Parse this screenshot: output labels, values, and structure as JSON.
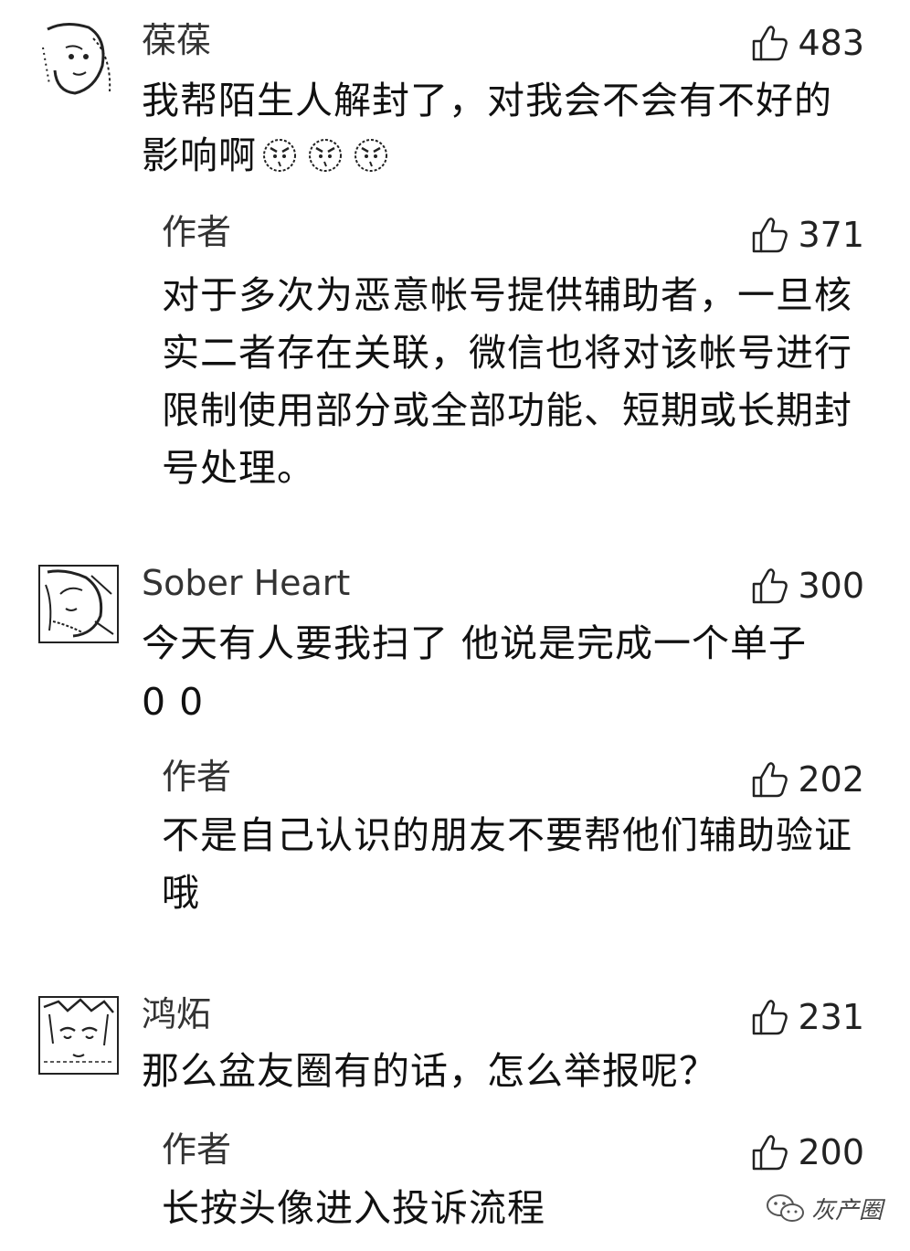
{
  "comments": [
    {
      "name": "葆葆",
      "likes": "483",
      "text": "我帮陌生人解封了，对我会不会有不好的影响啊",
      "emojis": [
        "angry-face-icon",
        "angry-face-icon",
        "angry-face-icon"
      ],
      "reply": {
        "name": "作者",
        "likes": "371",
        "text": "对于多次为恶意帐号提供辅助者，一旦核实二者存在关联，微信也将对该帐号进行限制使用部分或全部功能、短期或长期封号处理。"
      }
    },
    {
      "name": "Sober Heart",
      "likes": "300",
      "text": "今天有人要我扫了 他说是完成一个单子",
      "text2": "0 0",
      "reply": {
        "name": "作者",
        "likes": "202",
        "text": "不是自己认识的朋友不要帮他们辅助验证哦"
      }
    },
    {
      "name": "鸿炻",
      "likes": "231",
      "text": "那么盆友圈有的话，怎么举报呢？",
      "reply": {
        "name": "作者",
        "likes": "200",
        "text": "长按头像进入投诉流程"
      }
    }
  ],
  "watermark": {
    "text": "灰产圈",
    "icon": "wechat-icon"
  }
}
